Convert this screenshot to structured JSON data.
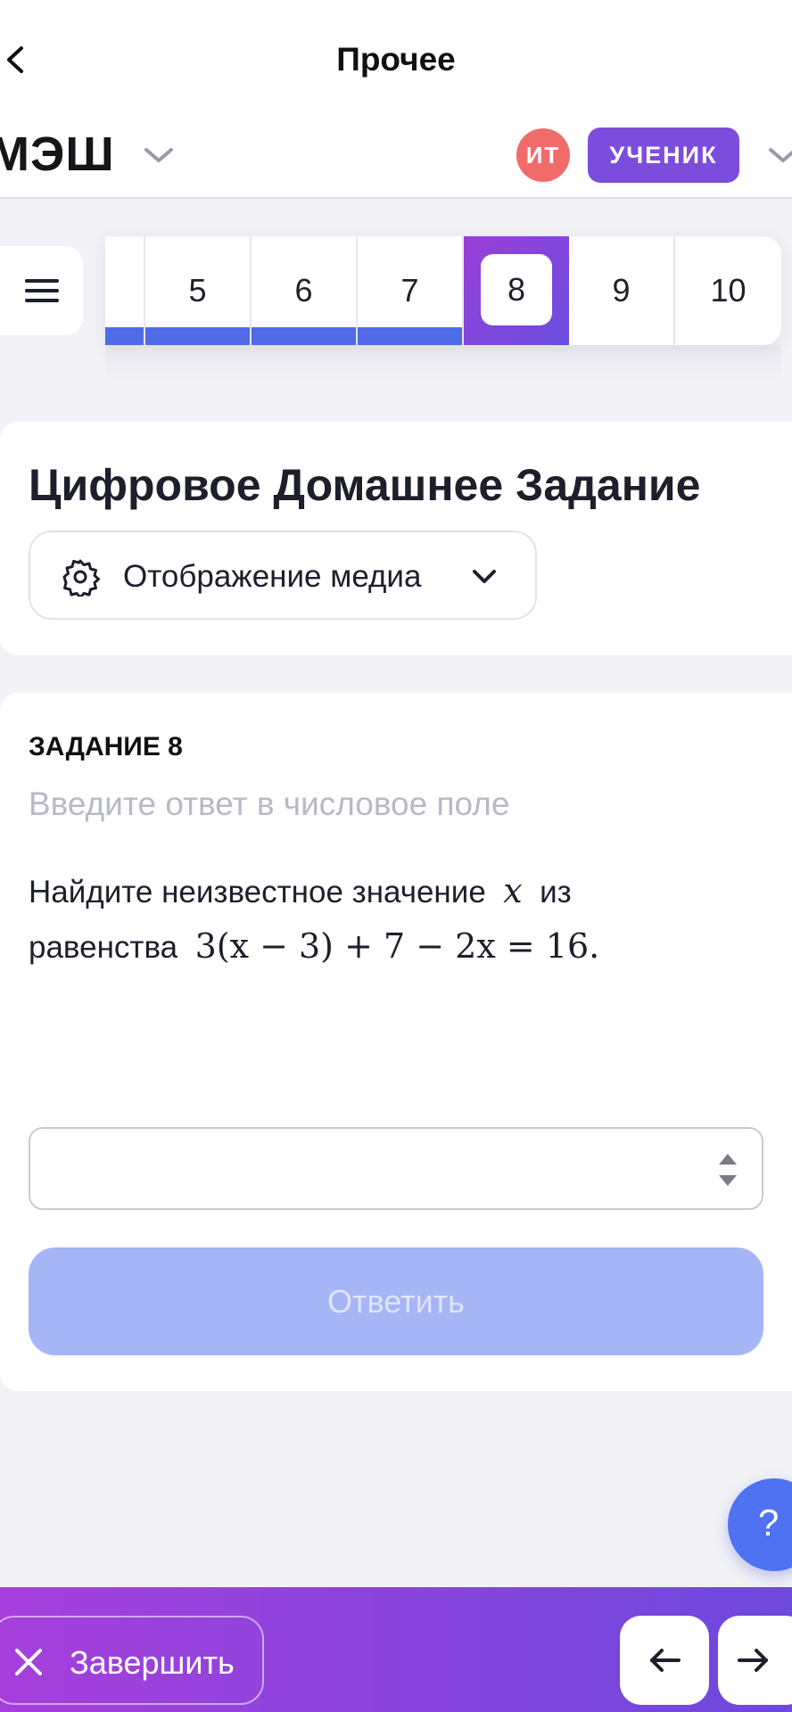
{
  "nav": {
    "title": "Прочее",
    "back_icon": "chevron-left-icon"
  },
  "header": {
    "brand": "МЭШ",
    "avatar_initials": "ИТ",
    "role_badge": "УЧЕНИК",
    "colors": {
      "avatar": "#f26b6b",
      "role_badge": "#7c4ddd"
    }
  },
  "question_nav": {
    "menu_icon": "hamburger-menu-icon",
    "items": [
      {
        "label": "5",
        "done": true
      },
      {
        "label": "6",
        "done": true
      },
      {
        "label": "7",
        "done": true
      },
      {
        "label": "8",
        "active": true
      },
      {
        "label": "9",
        "done": false
      },
      {
        "label": "10",
        "done": false
      }
    ],
    "colors": {
      "done_bar": "#4f6be8",
      "active_start": "#9a3ed8",
      "active_end": "#6a4fe0"
    }
  },
  "title_card": {
    "title": "Цифровое Домашнее Задание",
    "media_select_label": "Отображение медиа"
  },
  "task": {
    "heading": "ЗАДАНИЕ 8",
    "hint": "Введите ответ в числовое поле",
    "text_line1": "Найдите неизвестное значение",
    "variable": "x",
    "text_line1_end": "из",
    "text_line2": "равенства",
    "equation": "3(x − 3) + 7 − 2x = 16.",
    "answer_value": "",
    "submit_label": "Ответить",
    "colors": {
      "submit_bg": "#a6b5f6"
    }
  },
  "help": {
    "label": "?"
  },
  "bottom_bar": {
    "finish_label": "Завершить",
    "prev_icon": "arrow-left-icon",
    "next_icon": "arrow-right-icon",
    "colors": {
      "gradient_start": "#a53fdc",
      "gradient_end": "#6d49dc"
    }
  }
}
